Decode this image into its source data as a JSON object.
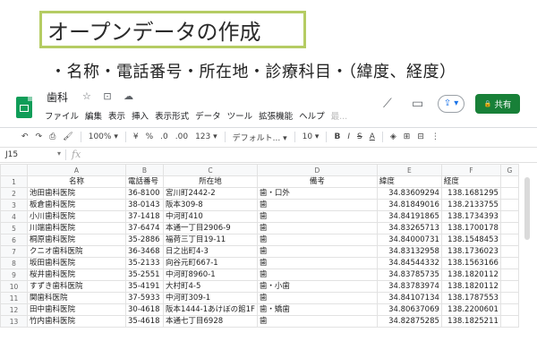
{
  "title": "オープンデータの作成",
  "subtitle": "・名称・電話番号・所在地・診療科目・（緯度、経度）",
  "app": {
    "doc_title": "歯科",
    "title_icons": "☆ ⊡ ☁",
    "menu": [
      "ファイル",
      "編集",
      "表示",
      "挿入",
      "表示形式",
      "データ",
      "ツール",
      "拡張機能",
      "ヘルプ"
    ],
    "menu_faded": "最...",
    "share_label": "共有",
    "share_dropdown_glyph": "⇪ ▾",
    "share_lock_glyph": "🔒"
  },
  "toolbar": {
    "undo": "↶",
    "redo": "↷",
    "print": "⎙",
    "paint_format": "🖌",
    "zoom": "100% ▾",
    "currency": "¥",
    "percent": "%",
    "decimal_dec": ".0",
    "decimal_inc": ".00",
    "format_more": "123 ▾",
    "font": "デフォルト... ▾",
    "font_size": "10 ▾",
    "bold": "B",
    "italic": "I",
    "strike": "S",
    "text_color": "A",
    "fill": "◈",
    "borders": "⊞",
    "merge": "⊟",
    "more": "⋮"
  },
  "formula_bar": {
    "cell_ref": "J15",
    "arrow": "▾",
    "fx": "fx"
  },
  "sheet": {
    "columns": [
      "A",
      "B",
      "C",
      "D",
      "E",
      "F",
      "G"
    ],
    "rows": [
      {
        "n": "1",
        "cells": [
          "名称",
          "電話番号",
          "所在地",
          "備考",
          "緯度",
          "経度"
        ]
      },
      {
        "n": "2",
        "cells": [
          "池田歯科医院",
          "36-8100",
          "宮川町2442-2",
          "歯・口外",
          "34.83609294",
          "138.1681295"
        ]
      },
      {
        "n": "3",
        "cells": [
          "板倉歯科医院",
          "38-0143",
          "阪本309-8",
          "歯",
          "34.81849016",
          "138.2133755"
        ]
      },
      {
        "n": "4",
        "cells": [
          "小川歯科医院",
          "37-1418",
          "中河町410",
          "歯",
          "34.84191865",
          "138.1734393"
        ]
      },
      {
        "n": "5",
        "cells": [
          "川端歯科医院",
          "37-6474",
          "本通一丁目2906-9",
          "歯",
          "34.83265713",
          "138.1700178"
        ]
      },
      {
        "n": "6",
        "cells": [
          "桐原歯科医院",
          "35-2886",
          "福荷三丁目19-11",
          "歯",
          "34.84000731",
          "138.1548453"
        ]
      },
      {
        "n": "7",
        "cells": [
          "クニオ歯科医院",
          "36-3468",
          "日之出町4-3",
          "歯",
          "34.83132958",
          "138.1736023"
        ]
      },
      {
        "n": "8",
        "cells": [
          "坂田歯科医院",
          "35-2133",
          "向谷元町667-1",
          "歯",
          "34.84544332",
          "138.1563166"
        ]
      },
      {
        "n": "9",
        "cells": [
          "桜井歯科医院",
          "35-2551",
          "中河町8960-1",
          "歯",
          "34.83785735",
          "138.1820112"
        ]
      },
      {
        "n": "10",
        "cells": [
          "すずき歯科医院",
          "35-4191",
          "大村町4-5",
          "歯・小歯",
          "34.83783974",
          "138.1820112"
        ]
      },
      {
        "n": "11",
        "cells": [
          "関歯科医院",
          "37-5933",
          "中河町309-1",
          "歯",
          "34.84107134",
          "138.1787553"
        ]
      },
      {
        "n": "12",
        "cells": [
          "田中歯科医院",
          "30-4618",
          "阪本1444-1あけぼの館1F",
          "歯・矯歯",
          "34.80637069",
          "138.2200601"
        ]
      },
      {
        "n": "13",
        "cells": [
          "竹内歯科医院",
          "35-4618",
          "本通七丁目6928",
          "歯",
          "34.82875285",
          "138.1825211"
        ]
      }
    ]
  }
}
